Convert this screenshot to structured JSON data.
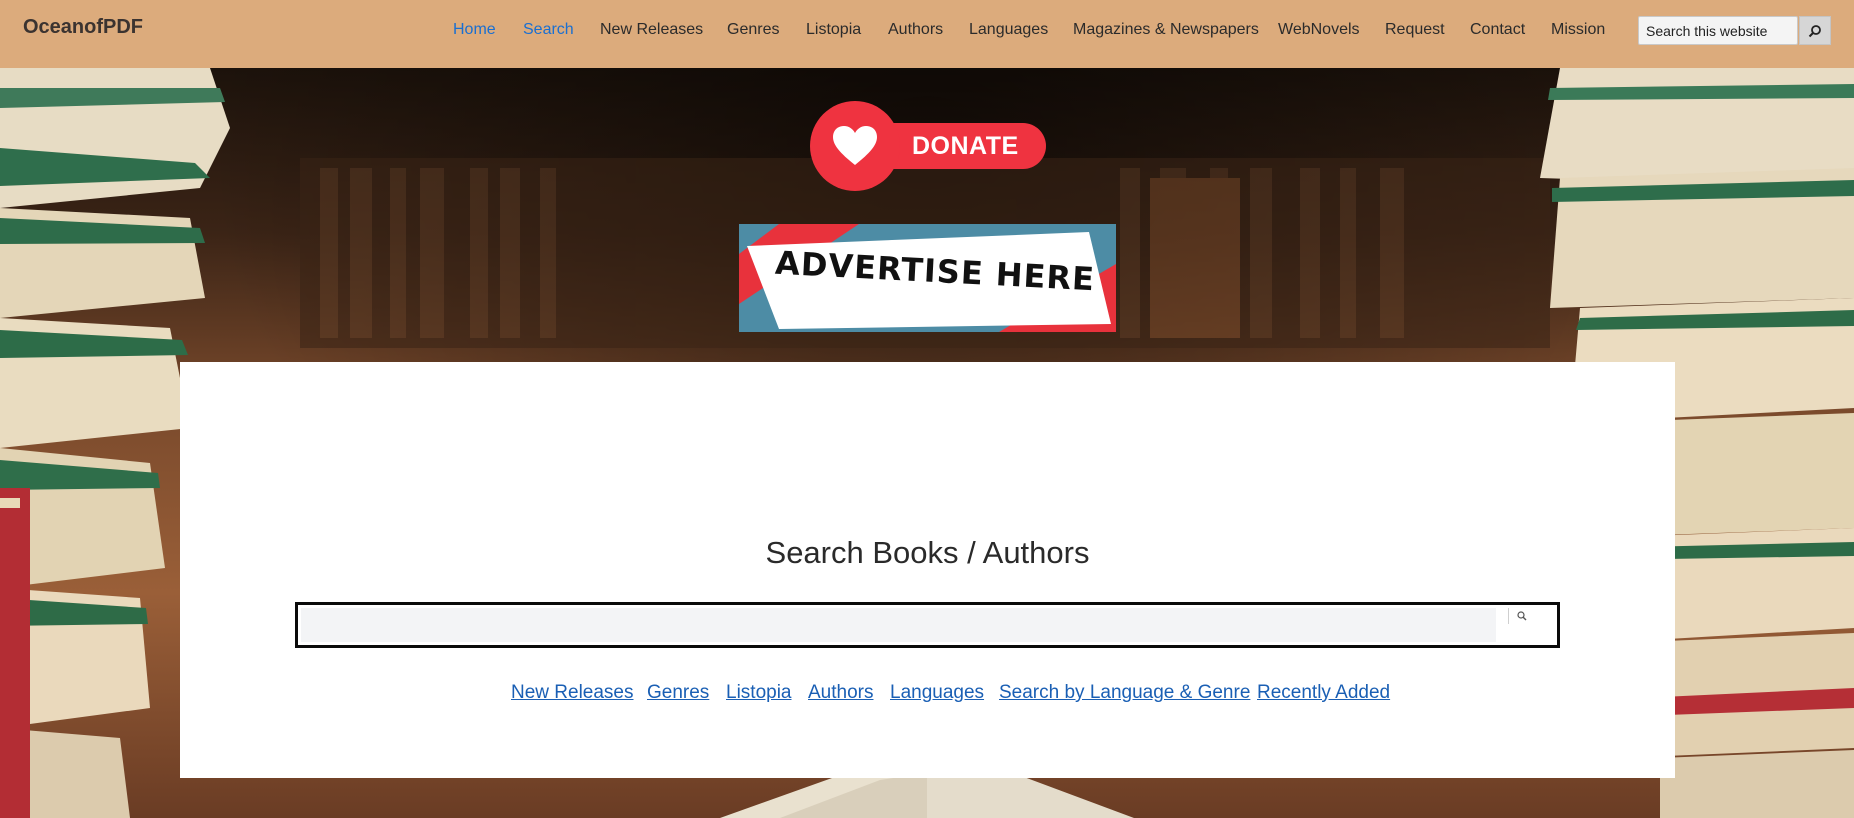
{
  "site": {
    "logo": "OceanofPDF"
  },
  "nav": {
    "items": [
      {
        "label": "Home",
        "active": true
      },
      {
        "label": "Search",
        "active": true
      },
      {
        "label": "New Releases",
        "active": false
      },
      {
        "label": "Genres",
        "active": false
      },
      {
        "label": "Listopia",
        "active": false
      },
      {
        "label": "Authors",
        "active": false
      },
      {
        "label": "Languages",
        "active": false
      },
      {
        "label": "Magazines & Newspapers",
        "active": false
      },
      {
        "label": "WebNovels",
        "active": false
      },
      {
        "label": "Request",
        "active": false
      },
      {
        "label": "Contact",
        "active": false
      },
      {
        "label": "Mission",
        "active": false
      }
    ]
  },
  "header_search": {
    "placeholder": "Search this website",
    "button_icon": "search-icon"
  },
  "donate": {
    "label": "DONATE",
    "icon": "heart-icon",
    "color": "#ef3340"
  },
  "advert": {
    "label": "ADVERTISE HERE"
  },
  "main": {
    "title": "Search Books / Authors",
    "search_value": "",
    "search_icon": "search-icon",
    "quick_links": [
      "New Releases",
      "Genres",
      "Listopia",
      "Authors",
      "Languages",
      "Search by Language & Genre",
      "Recently Added"
    ]
  },
  "colors": {
    "header_bg": "#dcab7c",
    "link_active": "#1a6fd1",
    "link": "#1a5fb4"
  }
}
